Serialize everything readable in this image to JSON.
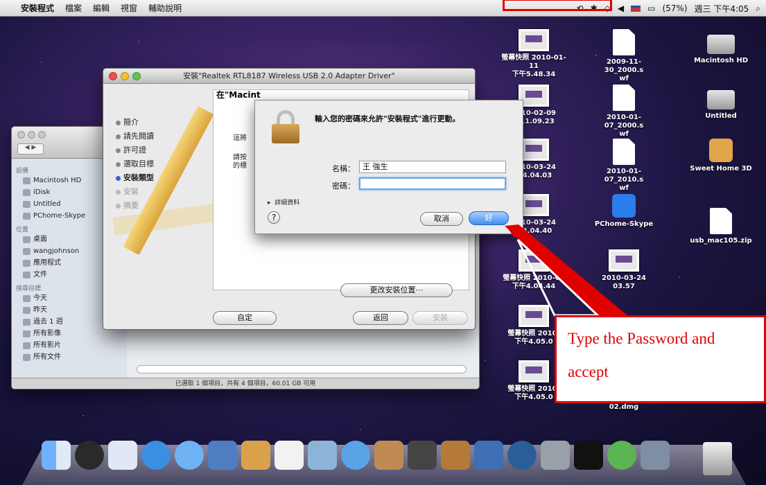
{
  "menubar": {
    "apple": "",
    "items": [
      "安裝程式",
      "檔案",
      "編輯",
      "視窗",
      "輔助說明"
    ],
    "battery": "(57%)",
    "clock": "週三 下午4:05"
  },
  "desktop_icons": [
    {
      "label": "螢幕快照 2010-01-11\n下午5.48.34",
      "kind": "shot"
    },
    {
      "label": "2009-11-30_2000.s\nwf",
      "kind": "doc"
    },
    {
      "label": "Macintosh HD",
      "kind": "disk"
    },
    {
      "label": "2010-02-09\n午11.09.23",
      "kind": "shot"
    },
    {
      "label": "2010-01-07_2000.s\nwf",
      "kind": "doc"
    },
    {
      "label": "Untitled",
      "kind": "disk"
    },
    {
      "label": "2010-03-24\n午4.04.03",
      "kind": "shot"
    },
    {
      "label": "2010-01-07_2010.s\nwf",
      "kind": "doc"
    },
    {
      "label": "Sweet Home 3D",
      "kind": "app"
    },
    {
      "label": "2010-03-24\n午4.04.40",
      "kind": "shot"
    },
    {
      "label": "PChome-Skype",
      "kind": "app"
    },
    {
      "label": "usb_mac105.zip",
      "kind": "zip"
    },
    {
      "label": "螢幕快照 2010-03\n下午4.04.44",
      "kind": "shot"
    },
    {
      "label": "2010-03-24\n03.57",
      "kind": "shot"
    },
    {
      "label": "螢幕快照 2010-\n下午4.05.0",
      "kind": "shot"
    },
    {
      "label": "螢幕快照 2010-\n下午4.05.0",
      "kind": "shot"
    },
    {
      "label": "02.dmg",
      "kind": "dmg"
    }
  ],
  "finder": {
    "nav": "◀ ▶",
    "sections": [
      {
        "title": "設備",
        "items": [
          "Macintosh HD",
          "iDisk",
          "Untitled",
          "PChome-Skype"
        ]
      },
      {
        "title": "位置",
        "items": [
          "桌面",
          "wangjohnson",
          "應用程式",
          "文件"
        ]
      },
      {
        "title": "搜尋目標",
        "items": [
          "今天",
          "昨天",
          "過去 1 週",
          "所有影像",
          "所有影片",
          "所有文件"
        ]
      }
    ],
    "status": "已選取 1 個項目，共有 4 個項目，60.01 GB 可用"
  },
  "installer": {
    "title": "安裝\"Realtek RTL8187 Wireless USB 2.0 Adapter Driver\"",
    "steps": [
      {
        "label": "簡介",
        "state": "done"
      },
      {
        "label": "請先閱讀",
        "state": "done"
      },
      {
        "label": "許可證",
        "state": "done"
      },
      {
        "label": "選取目標",
        "state": "done"
      },
      {
        "label": "安裝類型",
        "state": "active"
      },
      {
        "label": "安裝",
        "state": "dim"
      },
      {
        "label": "摘要",
        "state": "dim"
      }
    ],
    "content_heading": "在\"Macint",
    "content_line1": "這將",
    "content_line2": "請按",
    "content_line3": "的標",
    "change_location": "更改安裝位置⋯",
    "customize": "自定",
    "back": "返回",
    "install": "安裝"
  },
  "auth_sheet": {
    "message": "輸入您的密碼來允許\"安裝程式\"進行更動。",
    "name_label": "名稱：",
    "name_value": "王 強生",
    "password_label": "密碼：",
    "password_value": "",
    "details": "詳細資料",
    "help": "?",
    "cancel": "取消",
    "ok": "好"
  },
  "annotation": {
    "line1": "Type the Password and",
    "line2": "accept",
    "color": "#e00000"
  }
}
